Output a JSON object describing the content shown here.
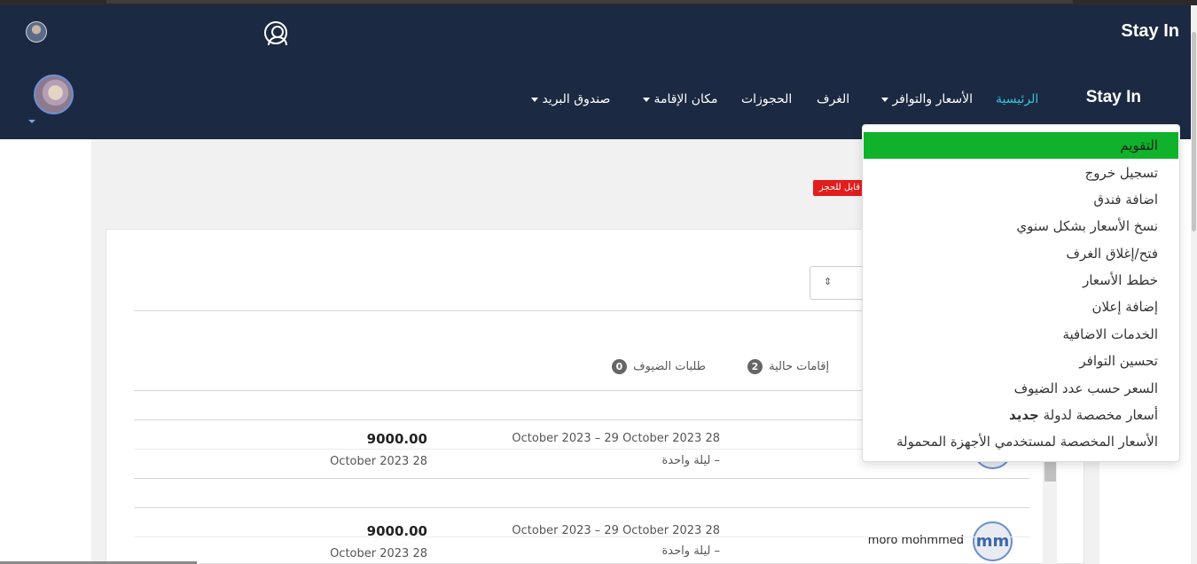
{
  "header": {
    "brand_top": "Stay In",
    "brand_nav": "Stay In",
    "user_icon": "user-circle-icon"
  },
  "nav": {
    "home": "الرئيسية",
    "rates": "الأسعار والتوافر",
    "rooms": "الغرف",
    "bookings": "الحجوزات",
    "property": "مكان الإقامة",
    "inbox": "صندوق البريد"
  },
  "dropdown": {
    "items": [
      "التقويم",
      "تسجيل خروج",
      "اضافة فندق",
      "نسخ الأسعار بشكل سنوي",
      "فتح/إغلاق الغرف",
      "خطط الأسعار",
      "إضافة إعلان",
      "الخدمات الاضافية",
      "تحسين التوافر",
      "السعر حسب عدد الضيوف",
      "أسعار مخصصة لدولة",
      "الأسعار المخصصة لمستخدمي الأجهزة المحمولة"
    ],
    "new_label": "جديد",
    "active_index": 0
  },
  "content": {
    "red_badge": "قابل للحجز",
    "select_icon": "sort-arrows-icon",
    "tabs": [
      {
        "label": "إقامات حالية",
        "count": "2"
      },
      {
        "label": "طلبات الضيوف",
        "count": "0"
      }
    ],
    "rows": [
      {
        "amount": "9000.00",
        "date": "October 2023 28",
        "range": "October 2023 – 29 October 2023 28",
        "nights": "ليلة واحدة –",
        "guest": "",
        "initials": ""
      },
      {
        "amount": "9000.00",
        "date": "October 2023 28",
        "range": "October 2023 – 29 October 2023 28",
        "nights": "ليلة واحدة –",
        "guest": "moro mohmmed",
        "initials": "mm"
      }
    ]
  },
  "colors": {
    "header_bg": "#1b2942",
    "nav_active": "#37c3d6",
    "dropdown_active": "#0fb22a",
    "badge_red": "#e21d1d"
  }
}
